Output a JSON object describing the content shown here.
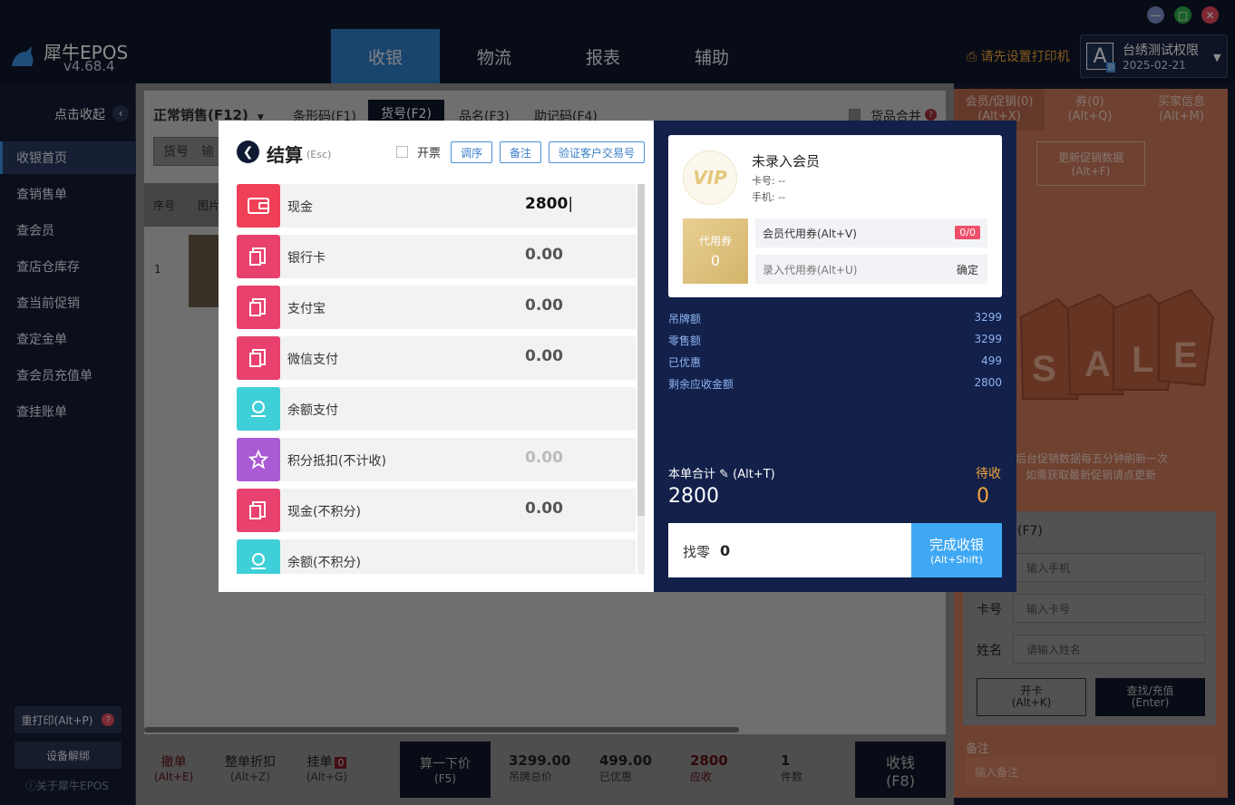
{
  "window": {
    "minimize": "—",
    "maximize": "□",
    "close": "✕"
  },
  "app": {
    "name": "犀牛EPOS",
    "version": "v4.68.4"
  },
  "nav": {
    "tabs": [
      {
        "label": "收银"
      },
      {
        "label": "物流"
      },
      {
        "label": "报表"
      },
      {
        "label": "辅助"
      }
    ]
  },
  "printer_notice": "请先设置打印机",
  "account": {
    "initial": "A",
    "badge": "测",
    "name": "台绣测试权限",
    "date": "2025-02-21"
  },
  "sidebar": {
    "collapse_label": "点击收起",
    "items": [
      {
        "label": "收银首页"
      },
      {
        "label": "查销售单"
      },
      {
        "label": "查会员"
      },
      {
        "label": "查店仓库存"
      },
      {
        "label": "查当前促销"
      },
      {
        "label": "查定金单"
      },
      {
        "label": "查会员充值单"
      },
      {
        "label": "查挂账单"
      }
    ],
    "reprint_label": "重打印(Alt+P)",
    "reprint_badge": "?",
    "device_unbind": "设备解绑",
    "about": "ⓘ关于犀牛EPOS"
  },
  "sale": {
    "mode": "正常销售(F12)",
    "search_tabs": [
      {
        "label": "条形码(F1)"
      },
      {
        "label": "货号(F2)"
      },
      {
        "label": "品名(F3)"
      },
      {
        "label": "助记码(F4)"
      }
    ],
    "merge_label": "货品合并",
    "merge_badge": "?",
    "search_prefix": "货号",
    "search_cut": "输",
    "col_no": "序号",
    "col_img": "图片",
    "row1_no": "1"
  },
  "checkout": {
    "title": "结算",
    "esc": "(Esc)",
    "invoice_label": "开票",
    "buttons": {
      "reorder": "调序",
      "remark": "备注",
      "verify": "验证客户交易号"
    },
    "payments": [
      {
        "label": "现金",
        "amount": "2800",
        "color": "#ef4057"
      },
      {
        "label": "银行卡",
        "amount": "0.00",
        "color": "#e8416e"
      },
      {
        "label": "支付宝",
        "amount": "0.00",
        "color": "#e8416e"
      },
      {
        "label": "微信支付",
        "amount": "0.00",
        "color": "#e8416e"
      },
      {
        "label": "余额支付",
        "amount": "",
        "color": "#3fcfd8"
      },
      {
        "label": "积分抵扣(不计收)",
        "amount": "0.00",
        "color": "#a95ad4"
      },
      {
        "label": "现金(不积分)",
        "amount": "0.00",
        "color": "#e8416e"
      },
      {
        "label": "余额(不积分)",
        "amount": "",
        "color": "#3fcfd8"
      }
    ],
    "member": {
      "vip": "VIP",
      "name": "未录入会员",
      "card_label": "卡号: --",
      "phone_label": "手机: --",
      "coupon_label": "代用券",
      "coupon_count": "0",
      "member_coupon": "会员代用券(Alt+V)",
      "member_coupon_badge": "0/0",
      "enter_coupon": "录入代用券(Alt+U)",
      "confirm": "确定"
    },
    "summary": [
      {
        "label": "吊牌额",
        "value": "3299"
      },
      {
        "label": "零售额",
        "value": "3299"
      },
      {
        "label": "已优惠",
        "value": "499"
      },
      {
        "label": "剩余应收金额",
        "value": "2800"
      }
    ],
    "total_label": "本单合计 ✎ (Alt+T)",
    "total_value": "2800",
    "due_label": "待收",
    "due_value": "0",
    "change_label": "找零",
    "change_value": "0",
    "finish_label": "完成收银",
    "finish_shortcut": "(Alt+Shift)"
  },
  "bottom": {
    "undo": "撤单",
    "undo_key": "(Alt+E)",
    "discount": "整单折扣",
    "discount_key": "(Alt+Z)",
    "hold": "挂单",
    "hold_badge": "0",
    "hold_key": "(Alt+G)",
    "calc": "算一下价",
    "calc_key": "(F5)",
    "tag_total": "3299.00",
    "tag_total_label": "吊牌总价",
    "discounted": "499.00",
    "discounted_label": "已优惠",
    "receivable": "2800",
    "receivable_label": "应收",
    "qty": "1",
    "qty_label": "件数",
    "checkout": "收钱",
    "checkout_key": "(F8)"
  },
  "right": {
    "tabs": [
      {
        "label": "会员/促销(0)",
        "key": "(Alt+X)"
      },
      {
        "label": "券(0)",
        "key": "(Alt+Q)"
      },
      {
        "label": "买家信息",
        "key": "(Alt+M)"
      }
    ],
    "refresh_label": "更新促销数据",
    "refresh_key": "(Alt+F)",
    "notice1": "后台促销数据每五分钟刷新一次",
    "notice2": "如需获取最新促销请点更新",
    "sale_tag_letters": "SALE",
    "form_key": "(F7)",
    "phone_placeholder": "输入手机",
    "card_label": "卡号",
    "card_placeholder": "输入卡号",
    "name_label": "姓名",
    "name_placeholder": "请输入姓名",
    "open_card": "开卡",
    "open_card_key": "(Alt+K)",
    "search_card": "查找/充值",
    "search_card_key": "(Enter)",
    "remark_label": "备注",
    "remark_placeholder": "输入备注"
  }
}
